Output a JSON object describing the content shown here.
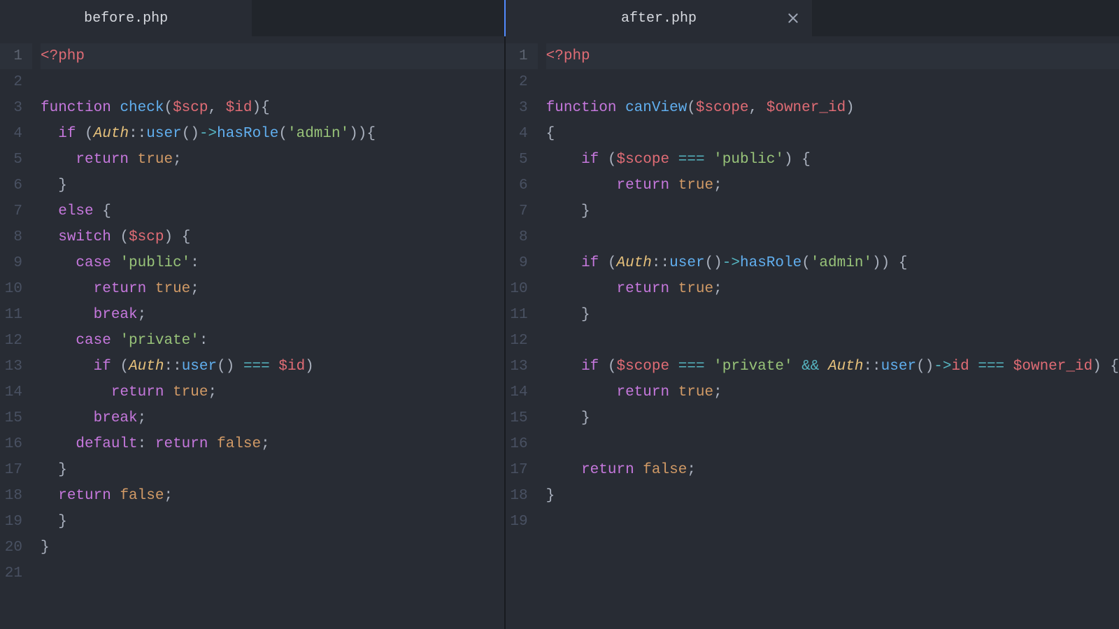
{
  "panes": [
    {
      "tabs": [
        {
          "label": "before.php",
          "active": true,
          "closable": false
        },
        {
          "label": "",
          "active": false,
          "closable": false
        }
      ],
      "highlight_line": 1,
      "lines": [
        [
          {
            "c": "t-tag",
            "t": "<?php"
          }
        ],
        [],
        [
          {
            "c": "t-kw",
            "t": "function"
          },
          {
            "c": "t-punc",
            "t": " "
          },
          {
            "c": "t-fn",
            "t": "check"
          },
          {
            "c": "t-punc",
            "t": "("
          },
          {
            "c": "t-var",
            "t": "$scp"
          },
          {
            "c": "t-punc",
            "t": ", "
          },
          {
            "c": "t-var",
            "t": "$id"
          },
          {
            "c": "t-punc",
            "t": "){"
          }
        ],
        [
          {
            "c": "t-punc",
            "t": "  "
          },
          {
            "c": "t-kw",
            "t": "if"
          },
          {
            "c": "t-punc",
            "t": " ("
          },
          {
            "c": "t-cls",
            "t": "Auth"
          },
          {
            "c": "t-punc",
            "t": "::"
          },
          {
            "c": "t-fn",
            "t": "user"
          },
          {
            "c": "t-punc",
            "t": "()"
          },
          {
            "c": "t-op",
            "t": "->"
          },
          {
            "c": "t-fn",
            "t": "hasRole"
          },
          {
            "c": "t-punc",
            "t": "("
          },
          {
            "c": "t-str",
            "t": "'admin'"
          },
          {
            "c": "t-punc",
            "t": ")){"
          }
        ],
        [
          {
            "c": "t-punc",
            "t": "    "
          },
          {
            "c": "t-kw",
            "t": "return"
          },
          {
            "c": "t-punc",
            "t": " "
          },
          {
            "c": "t-bool",
            "t": "true"
          },
          {
            "c": "t-punc",
            "t": ";"
          }
        ],
        [
          {
            "c": "t-punc",
            "t": "  }"
          }
        ],
        [
          {
            "c": "t-punc",
            "t": "  "
          },
          {
            "c": "t-kw",
            "t": "else"
          },
          {
            "c": "t-punc",
            "t": " {"
          }
        ],
        [
          {
            "c": "t-punc",
            "t": "  "
          },
          {
            "c": "t-kw",
            "t": "switch"
          },
          {
            "c": "t-punc",
            "t": " ("
          },
          {
            "c": "t-var",
            "t": "$scp"
          },
          {
            "c": "t-punc",
            "t": ") {"
          }
        ],
        [
          {
            "c": "t-punc",
            "t": "    "
          },
          {
            "c": "t-kw",
            "t": "case"
          },
          {
            "c": "t-punc",
            "t": " "
          },
          {
            "c": "t-str",
            "t": "'public'"
          },
          {
            "c": "t-punc",
            "t": ":"
          }
        ],
        [
          {
            "c": "t-punc",
            "t": "      "
          },
          {
            "c": "t-kw",
            "t": "return"
          },
          {
            "c": "t-punc",
            "t": " "
          },
          {
            "c": "t-bool",
            "t": "true"
          },
          {
            "c": "t-punc",
            "t": ";"
          }
        ],
        [
          {
            "c": "t-punc",
            "t": "      "
          },
          {
            "c": "t-kw",
            "t": "break"
          },
          {
            "c": "t-punc",
            "t": ";"
          }
        ],
        [
          {
            "c": "t-punc",
            "t": "    "
          },
          {
            "c": "t-kw",
            "t": "case"
          },
          {
            "c": "t-punc",
            "t": " "
          },
          {
            "c": "t-str",
            "t": "'private'"
          },
          {
            "c": "t-punc",
            "t": ":"
          }
        ],
        [
          {
            "c": "t-punc",
            "t": "      "
          },
          {
            "c": "t-kw",
            "t": "if"
          },
          {
            "c": "t-punc",
            "t": " ("
          },
          {
            "c": "t-cls",
            "t": "Auth"
          },
          {
            "c": "t-punc",
            "t": "::"
          },
          {
            "c": "t-fn",
            "t": "user"
          },
          {
            "c": "t-punc",
            "t": "() "
          },
          {
            "c": "t-op",
            "t": "==="
          },
          {
            "c": "t-punc",
            "t": " "
          },
          {
            "c": "t-var",
            "t": "$id"
          },
          {
            "c": "t-punc",
            "t": ")"
          }
        ],
        [
          {
            "c": "t-punc",
            "t": "        "
          },
          {
            "c": "t-kw",
            "t": "return"
          },
          {
            "c": "t-punc",
            "t": " "
          },
          {
            "c": "t-bool",
            "t": "true"
          },
          {
            "c": "t-punc",
            "t": ";"
          }
        ],
        [
          {
            "c": "t-punc",
            "t": "      "
          },
          {
            "c": "t-kw",
            "t": "break"
          },
          {
            "c": "t-punc",
            "t": ";"
          }
        ],
        [
          {
            "c": "t-punc",
            "t": "    "
          },
          {
            "c": "t-kw",
            "t": "default"
          },
          {
            "c": "t-punc",
            "t": ": "
          },
          {
            "c": "t-kw",
            "t": "return"
          },
          {
            "c": "t-punc",
            "t": " "
          },
          {
            "c": "t-bool",
            "t": "false"
          },
          {
            "c": "t-punc",
            "t": ";"
          }
        ],
        [
          {
            "c": "t-punc",
            "t": "  }"
          }
        ],
        [
          {
            "c": "t-punc",
            "t": "  "
          },
          {
            "c": "t-kw",
            "t": "return"
          },
          {
            "c": "t-punc",
            "t": " "
          },
          {
            "c": "t-bool",
            "t": "false"
          },
          {
            "c": "t-punc",
            "t": ";"
          }
        ],
        [
          {
            "c": "t-punc",
            "t": "  }"
          }
        ],
        [
          {
            "c": "t-punc",
            "t": "}"
          }
        ],
        []
      ]
    },
    {
      "tabs": [
        {
          "label": "after.php",
          "active": true,
          "closable": true
        },
        {
          "label": "",
          "active": false,
          "closable": false
        }
      ],
      "highlight_line": 1,
      "lines": [
        [
          {
            "c": "t-tag",
            "t": "<?php"
          }
        ],
        [],
        [
          {
            "c": "t-kw",
            "t": "function"
          },
          {
            "c": "t-punc",
            "t": " "
          },
          {
            "c": "t-fn",
            "t": "canView"
          },
          {
            "c": "t-punc",
            "t": "("
          },
          {
            "c": "t-var",
            "t": "$scope"
          },
          {
            "c": "t-punc",
            "t": ", "
          },
          {
            "c": "t-var",
            "t": "$owner_id"
          },
          {
            "c": "t-punc",
            "t": ")"
          }
        ],
        [
          {
            "c": "t-punc",
            "t": "{"
          }
        ],
        [
          {
            "c": "t-punc",
            "t": "    "
          },
          {
            "c": "t-kw",
            "t": "if"
          },
          {
            "c": "t-punc",
            "t": " ("
          },
          {
            "c": "t-var",
            "t": "$scope"
          },
          {
            "c": "t-punc",
            "t": " "
          },
          {
            "c": "t-op",
            "t": "==="
          },
          {
            "c": "t-punc",
            "t": " "
          },
          {
            "c": "t-str",
            "t": "'public'"
          },
          {
            "c": "t-punc",
            "t": ") {"
          }
        ],
        [
          {
            "c": "t-punc",
            "t": "        "
          },
          {
            "c": "t-kw",
            "t": "return"
          },
          {
            "c": "t-punc",
            "t": " "
          },
          {
            "c": "t-bool",
            "t": "true"
          },
          {
            "c": "t-punc",
            "t": ";"
          }
        ],
        [
          {
            "c": "t-punc",
            "t": "    }"
          }
        ],
        [],
        [
          {
            "c": "t-punc",
            "t": "    "
          },
          {
            "c": "t-kw",
            "t": "if"
          },
          {
            "c": "t-punc",
            "t": " ("
          },
          {
            "c": "t-cls",
            "t": "Auth"
          },
          {
            "c": "t-punc",
            "t": "::"
          },
          {
            "c": "t-fn",
            "t": "user"
          },
          {
            "c": "t-punc",
            "t": "()"
          },
          {
            "c": "t-op",
            "t": "->"
          },
          {
            "c": "t-fn",
            "t": "hasRole"
          },
          {
            "c": "t-punc",
            "t": "("
          },
          {
            "c": "t-str",
            "t": "'admin'"
          },
          {
            "c": "t-punc",
            "t": ")) {"
          }
        ],
        [
          {
            "c": "t-punc",
            "t": "        "
          },
          {
            "c": "t-kw",
            "t": "return"
          },
          {
            "c": "t-punc",
            "t": " "
          },
          {
            "c": "t-bool",
            "t": "true"
          },
          {
            "c": "t-punc",
            "t": ";"
          }
        ],
        [
          {
            "c": "t-punc",
            "t": "    }"
          }
        ],
        [],
        [
          {
            "c": "t-punc",
            "t": "    "
          },
          {
            "c": "t-kw",
            "t": "if"
          },
          {
            "c": "t-punc",
            "t": " ("
          },
          {
            "c": "t-var",
            "t": "$scope"
          },
          {
            "c": "t-punc",
            "t": " "
          },
          {
            "c": "t-op",
            "t": "==="
          },
          {
            "c": "t-punc",
            "t": " "
          },
          {
            "c": "t-str",
            "t": "'private'"
          },
          {
            "c": "t-punc",
            "t": " "
          },
          {
            "c": "t-op",
            "t": "&&"
          },
          {
            "c": "t-punc",
            "t": " "
          },
          {
            "c": "t-cls",
            "t": "Auth"
          },
          {
            "c": "t-punc",
            "t": "::"
          },
          {
            "c": "t-fn",
            "t": "user"
          },
          {
            "c": "t-punc",
            "t": "()"
          },
          {
            "c": "t-op",
            "t": "->"
          },
          {
            "c": "t-prop",
            "t": "id"
          },
          {
            "c": "t-punc",
            "t": " "
          },
          {
            "c": "t-op",
            "t": "==="
          },
          {
            "c": "t-punc",
            "t": " "
          },
          {
            "c": "t-var",
            "t": "$owner_id"
          },
          {
            "c": "t-punc",
            "t": ") {"
          }
        ],
        [
          {
            "c": "t-punc",
            "t": "        "
          },
          {
            "c": "t-kw",
            "t": "return"
          },
          {
            "c": "t-punc",
            "t": " "
          },
          {
            "c": "t-bool",
            "t": "true"
          },
          {
            "c": "t-punc",
            "t": ";"
          }
        ],
        [
          {
            "c": "t-punc",
            "t": "    }"
          }
        ],
        [],
        [
          {
            "c": "t-punc",
            "t": "    "
          },
          {
            "c": "t-kw",
            "t": "return"
          },
          {
            "c": "t-punc",
            "t": " "
          },
          {
            "c": "t-bool",
            "t": "false"
          },
          {
            "c": "t-punc",
            "t": ";"
          }
        ],
        [
          {
            "c": "t-punc",
            "t": "}"
          }
        ],
        []
      ]
    }
  ]
}
